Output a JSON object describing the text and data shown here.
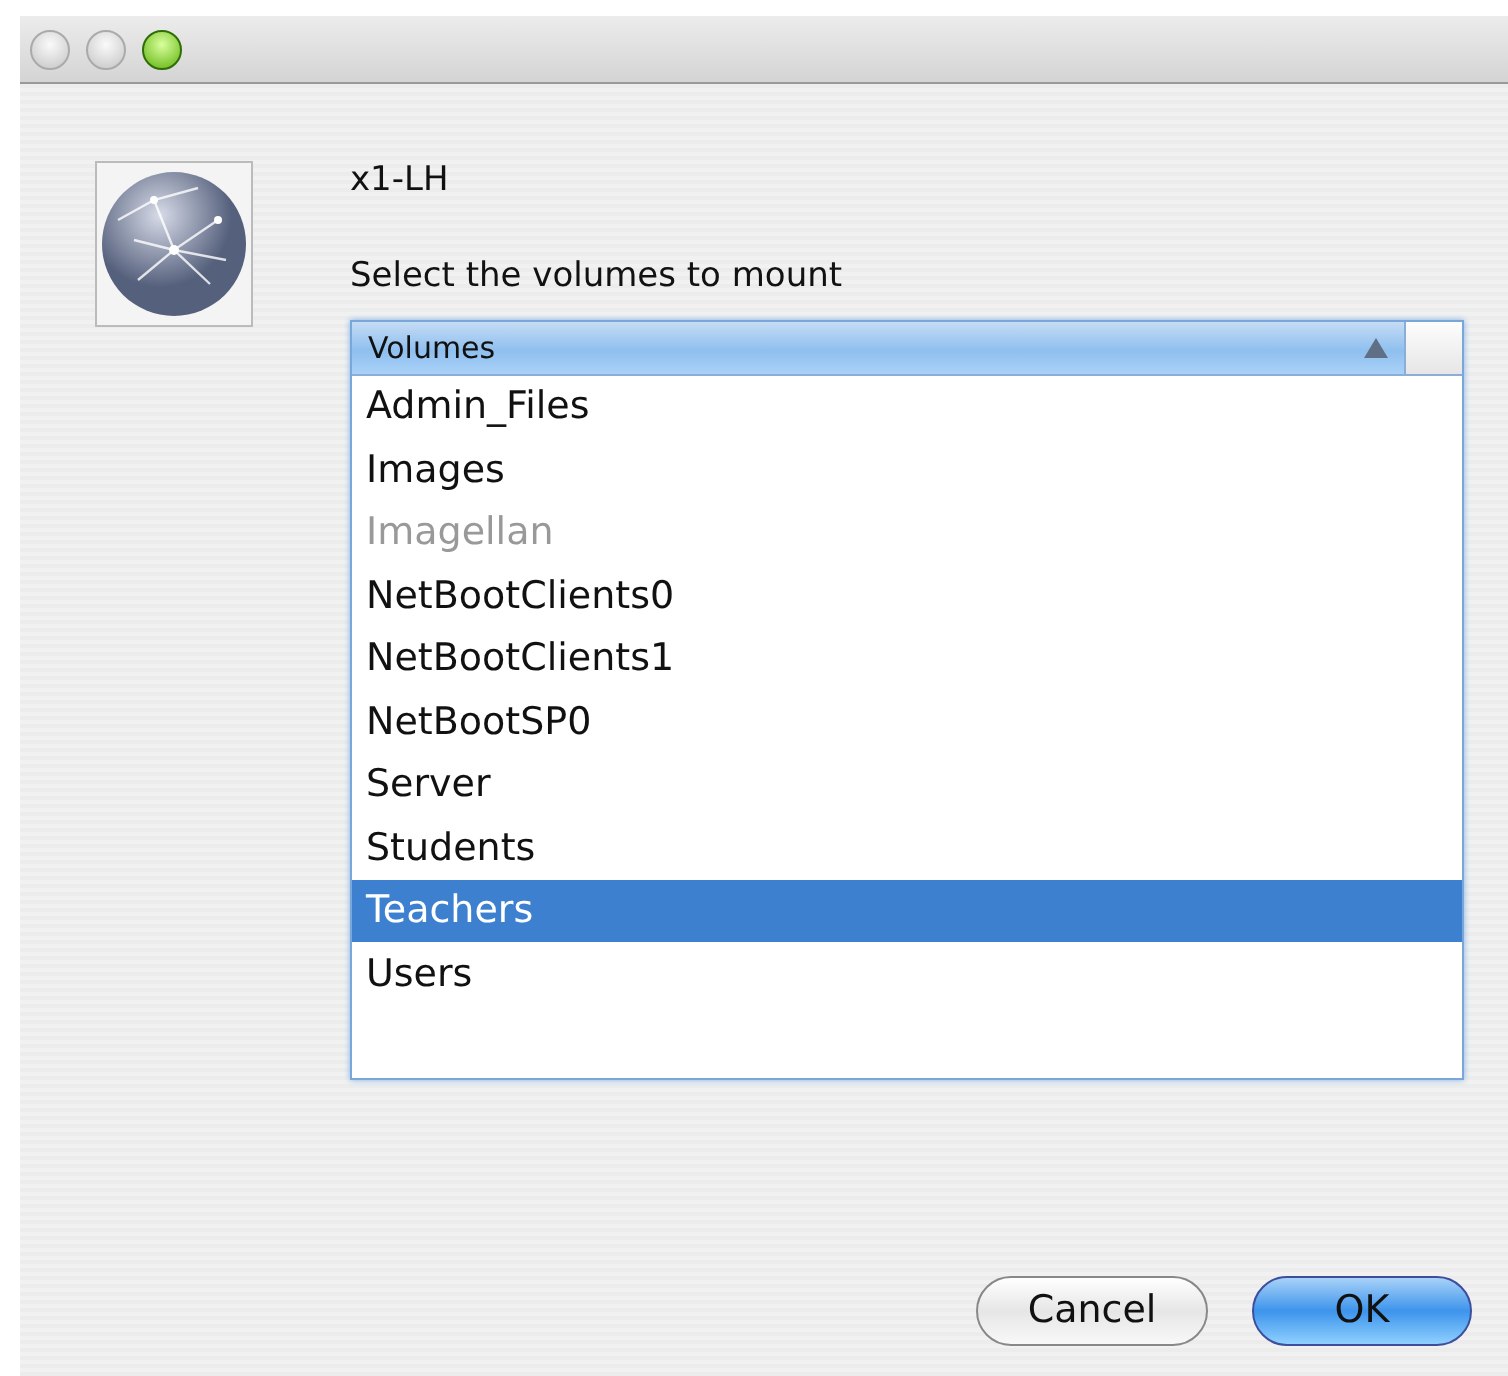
{
  "window": {
    "title": "x1-LH"
  },
  "prompt": "Select the volumes to mount",
  "table": {
    "columns": [
      "Volumes"
    ],
    "rows": [
      {
        "name": "Admin_Files",
        "disabled": false,
        "selected": false
      },
      {
        "name": "Images",
        "disabled": false,
        "selected": false
      },
      {
        "name": "Imagellan",
        "disabled": true,
        "selected": false
      },
      {
        "name": "NetBootClients0",
        "disabled": false,
        "selected": false
      },
      {
        "name": "NetBootClients1",
        "disabled": false,
        "selected": false
      },
      {
        "name": "NetBootSP0",
        "disabled": false,
        "selected": false
      },
      {
        "name": "Server",
        "disabled": false,
        "selected": false
      },
      {
        "name": "Students",
        "disabled": false,
        "selected": false
      },
      {
        "name": "Teachers",
        "disabled": false,
        "selected": true
      },
      {
        "name": "Users",
        "disabled": false,
        "selected": false
      }
    ]
  },
  "buttons": [
    {
      "label": "Cancel",
      "kind": "plain"
    },
    {
      "label": "OK",
      "kind": "default"
    }
  ]
}
